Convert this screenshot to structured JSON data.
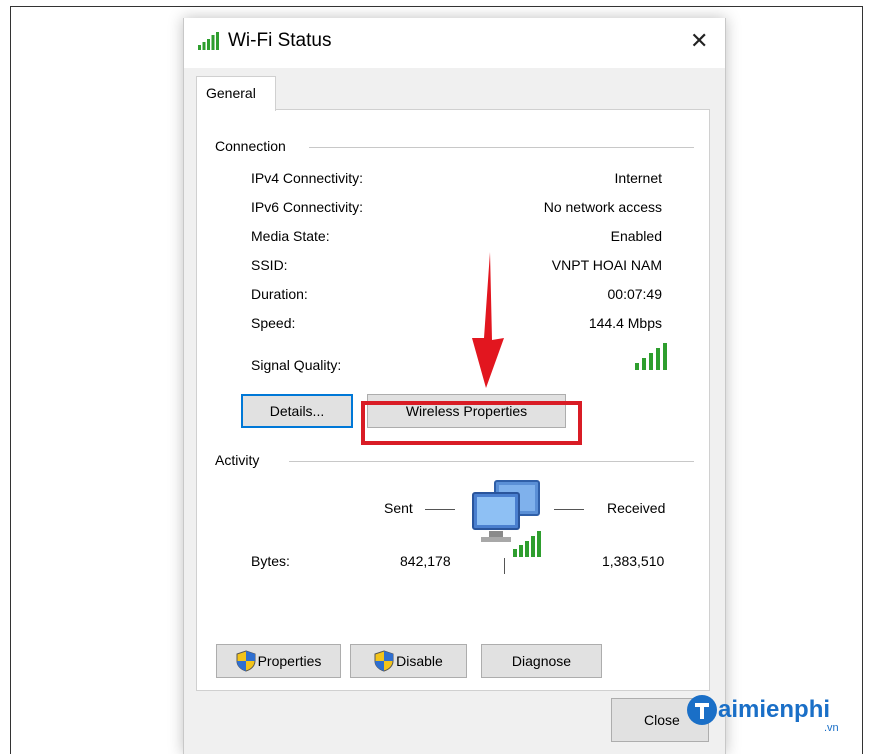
{
  "window": {
    "title": "Wi-Fi Status",
    "close_symbol": "✕"
  },
  "tabs": [
    {
      "label": "General"
    }
  ],
  "connection": {
    "heading": "Connection",
    "rows": [
      {
        "label": "IPv4 Connectivity:",
        "value": "Internet"
      },
      {
        "label": "IPv6 Connectivity:",
        "value": "No network access"
      },
      {
        "label": "Media State:",
        "value": "Enabled"
      },
      {
        "label": "SSID:",
        "value": "VNPT HOAI NAM"
      },
      {
        "label": "Duration:",
        "value": "00:07:49"
      },
      {
        "label": "Speed:",
        "value": "144.4 Mbps"
      }
    ],
    "signal_label": "Signal Quality:",
    "signal_bars": 5,
    "details_button": "Details...",
    "wireless_properties_button": "Wireless Properties"
  },
  "activity": {
    "heading": "Activity",
    "sent_label": "Sent",
    "received_label": "Received",
    "bytes_label": "Bytes:",
    "bytes_sent": "842,178",
    "bytes_received": "1,383,510"
  },
  "buttons": {
    "properties": "Properties",
    "disable": "Disable",
    "diagnose": "Diagnose",
    "close": "Close"
  },
  "watermark": {
    "text": "aimienphi",
    "suffix": ".vn"
  },
  "colors": {
    "highlight": "#d91c25",
    "signal": "#2e9e2e",
    "focus": "#0078d7"
  }
}
